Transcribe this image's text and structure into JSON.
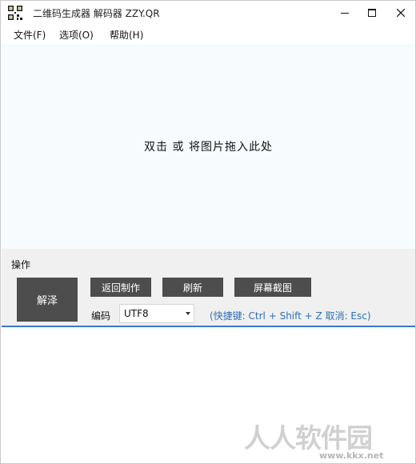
{
  "window": {
    "title": "二维码生成器 解码器 ZZY.QR",
    "icon": "qr-code-icon",
    "controls": [
      "minimize-icon",
      "maximize-icon",
      "close-icon"
    ]
  },
  "menu": {
    "file": "文件(F)",
    "options": "选项(O)",
    "help": "帮助(H)"
  },
  "drop_area": {
    "hint": "双击 或 将图片拖入此处"
  },
  "operations": {
    "label": "操作",
    "decode_button": "解泽",
    "back_button": "返回制作",
    "refresh_button": "刷新",
    "capture_button": "屏幕截图",
    "encoding_label": "编码",
    "encoding_value": "UTF8",
    "shortcut_hint": "(快捷键: Ctrl + Shift + Z  取消: Esc)"
  },
  "watermark": {
    "text": "人人软件园",
    "url": "www.kkx.net"
  },
  "colors": {
    "button_bg": "#4d4d4d",
    "panel_bg": "#f0f0f0",
    "drop_bg": "#f7fbfd",
    "accent_border": "#3a78c9",
    "hint_blue": "#2e6fb7"
  }
}
